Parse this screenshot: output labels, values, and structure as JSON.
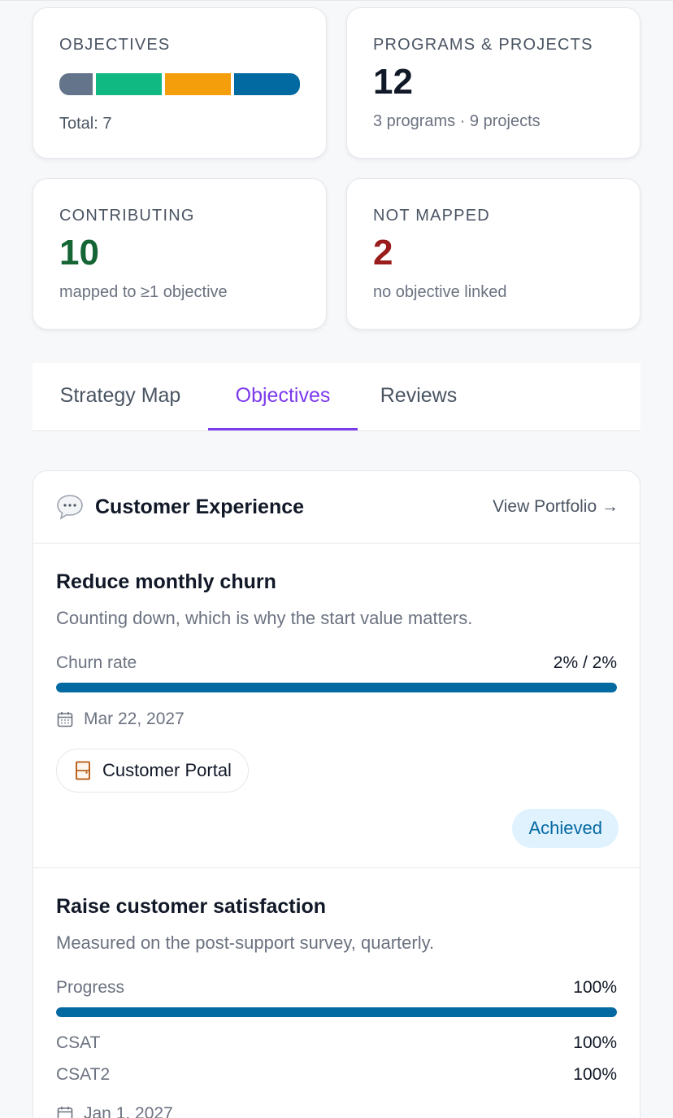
{
  "stats": {
    "objectives": {
      "label": "OBJECTIVES",
      "segments": [
        {
          "color": "#64748b",
          "share": 1
        },
        {
          "color": "#10b981",
          "share": 2
        },
        {
          "color": "#f59e0b",
          "share": 2
        },
        {
          "color": "#0369a1",
          "share": 2
        }
      ],
      "total_text": "Total: 7"
    },
    "programs": {
      "label": "PROGRAMS & PROJECTS",
      "value": "12",
      "sub": "3 programs · 9 projects"
    },
    "contributing": {
      "label": "CONTRIBUTING",
      "value": "10",
      "value_color": "#166534",
      "sub": "mapped to ≥1 objective"
    },
    "not_mapped": {
      "label": "NOT MAPPED",
      "value": "2",
      "value_color": "#991b1b",
      "sub": "no objective linked"
    }
  },
  "tabs": [
    {
      "label": "Strategy Map",
      "active": false
    },
    {
      "label": "Objectives",
      "active": true
    },
    {
      "label": "Reviews",
      "active": false
    }
  ],
  "portfolio": {
    "icon": "speech-bubble-icon",
    "title": "Customer Experience",
    "view_link": "View Portfolio →",
    "objectives": [
      {
        "title": "Reduce monthly churn",
        "description": "Counting down, which is why the start value matters.",
        "metric_label": "Churn rate",
        "metric_value": "2% / 2%",
        "progress": 1.0,
        "date": "Mar 22, 2027",
        "project_chip": "Customer Portal",
        "project_icon": "door-icon",
        "status": "Achieved"
      },
      {
        "title": "Raise customer satisfaction",
        "description": "Measured on the post-support survey, quarterly.",
        "metric_label": "Progress",
        "metric_value": "100%",
        "progress": 1.0,
        "key_results": [
          {
            "label": "CSAT",
            "value": "100%"
          },
          {
            "label": "CSAT2",
            "value": "100%"
          }
        ],
        "date": "Jan 1, 2027"
      }
    ]
  },
  "colors": {
    "accent": "#7c3aed",
    "progress_fill": "#0369a1"
  }
}
